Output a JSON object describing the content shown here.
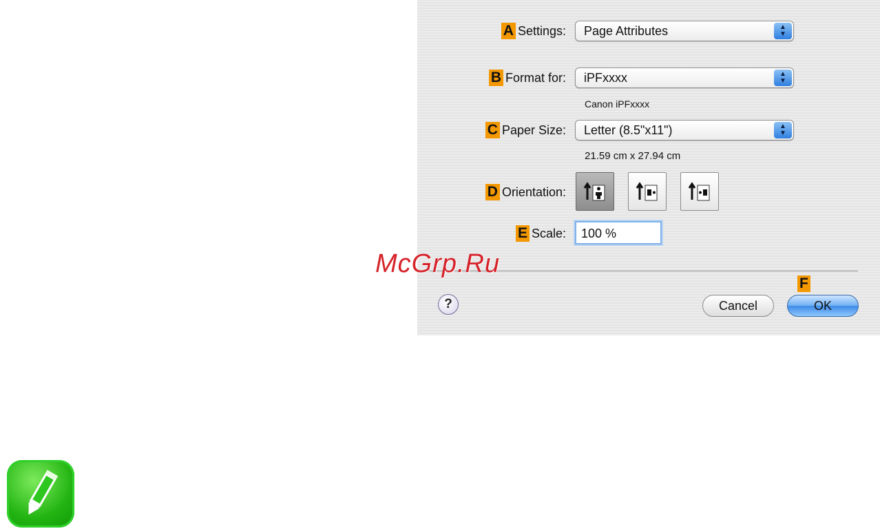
{
  "dialog": {
    "settings": {
      "badge": "A",
      "label": "Settings:",
      "value": "Page Attributes"
    },
    "format_for": {
      "badge": "B",
      "label": "Format for:",
      "value": "iPFxxxx",
      "sub": "Canon iPFxxxx"
    },
    "paper_size": {
      "badge": "C",
      "label": "Paper Size:",
      "value": "Letter (8.5\"x11\")",
      "sub": "21.59 cm x 27.94 cm"
    },
    "orientation": {
      "badge": "D",
      "label": "Orientation:",
      "options": [
        "portrait",
        "landscape-left",
        "landscape-right"
      ],
      "selected": "portrait"
    },
    "scale": {
      "badge": "E",
      "label": "Scale:",
      "value": "100 %"
    },
    "footer": {
      "help_label": "?",
      "cancel_label": "Cancel",
      "ok_badge": "F",
      "ok_label": "OK"
    }
  },
  "watermark": "McGrp.Ru",
  "note_icon": "pencil-note-icon",
  "colors": {
    "badge": "#f39800",
    "ok_blue": "#3d8ae7",
    "watermark": "#d6232a",
    "note_green": "#23b512"
  }
}
